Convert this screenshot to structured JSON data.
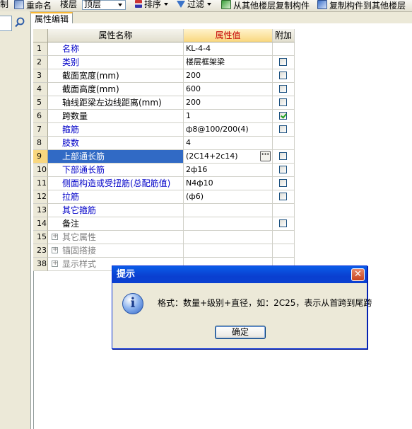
{
  "toolbar": {
    "cut_label": "制",
    "rename_label": "重命名",
    "floor_label": "楼层",
    "floor_value": "顶层",
    "sort_label": "排序",
    "filter_label": "过滤",
    "copy_from_label": "从其他楼层复制构件",
    "copy_to_label": "复制构件到其他楼层"
  },
  "tab": {
    "label": "属性编辑"
  },
  "grid": {
    "headers": {
      "name": "属性名称",
      "value": "属性值",
      "add": "附加"
    },
    "rows": [
      {
        "num": "1",
        "name": "名称",
        "value": "KL-4-4",
        "style": "blue",
        "checkbox": "none"
      },
      {
        "num": "2",
        "name": "类别",
        "value": "楼层框架梁",
        "style": "blue",
        "checkbox": "off"
      },
      {
        "num": "3",
        "name": "截面宽度(mm)",
        "value": "200",
        "style": "black",
        "checkbox": "off"
      },
      {
        "num": "4",
        "name": "截面高度(mm)",
        "value": "600",
        "style": "black",
        "checkbox": "off"
      },
      {
        "num": "5",
        "name": "轴线距梁左边线距离(mm)",
        "value": "200",
        "style": "black",
        "checkbox": "off"
      },
      {
        "num": "6",
        "name": "跨数量",
        "value": "1",
        "style": "black",
        "checkbox": "on"
      },
      {
        "num": "7",
        "name": "箍筋",
        "value": "ф8@100/200(4)",
        "style": "blue",
        "checkbox": "off"
      },
      {
        "num": "8",
        "name": "肢数",
        "value": "4",
        "style": "blue",
        "checkbox": "none"
      },
      {
        "num": "9",
        "name": "上部通长筋",
        "value": "(2C14+2c14)",
        "style": "blue",
        "checkbox": "off"
      },
      {
        "num": "10",
        "name": "下部通长筋",
        "value": "2ф16",
        "style": "blue",
        "checkbox": "off"
      },
      {
        "num": "11",
        "name": "侧面构造或受扭筋(总配筋值)",
        "value": "N4ф10",
        "style": "blue",
        "checkbox": "off"
      },
      {
        "num": "12",
        "name": "拉筋",
        "value": "(ф6)",
        "style": "blue",
        "checkbox": "off"
      },
      {
        "num": "13",
        "name": "其它箍筋",
        "value": "",
        "style": "blue",
        "checkbox": "none"
      },
      {
        "num": "14",
        "name": "备注",
        "value": "",
        "style": "black",
        "checkbox": "off"
      },
      {
        "num": "15",
        "name": "其它属性",
        "value": "",
        "style": "gray",
        "checkbox": "none",
        "expander": "+"
      },
      {
        "num": "23",
        "name": "锚固搭接",
        "value": "",
        "style": "gray",
        "checkbox": "none",
        "expander": "+"
      },
      {
        "num": "38",
        "name": "显示样式",
        "value": "",
        "style": "gray",
        "checkbox": "none",
        "expander": "+"
      }
    ],
    "selected_row": "9",
    "ellipsis_label": "···"
  },
  "dialog": {
    "title": "提示",
    "close_label": "✕",
    "icon_label": "i",
    "message": "格式：数量+级别+直径，如：2C25，表示从首跨到尾跨",
    "ok_label": "确定"
  }
}
